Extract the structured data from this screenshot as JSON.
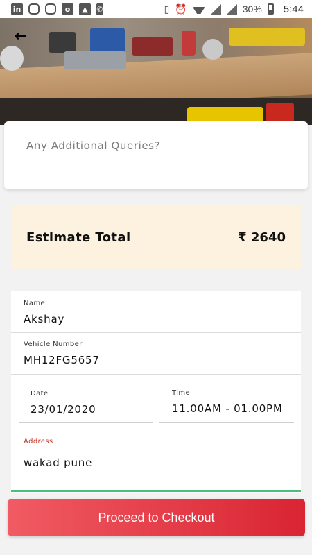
{
  "status_bar": {
    "battery": "30%",
    "time": "5:44",
    "left_icons": [
      "linkedin-icon",
      "instagram-icon",
      "instagram-icon",
      "outlook-icon",
      "gallery-icon",
      "phone-icon"
    ],
    "right_icons": [
      "vibrate-icon",
      "alarm-icon",
      "wifi-icon",
      "signal-icon",
      "signal-icon",
      "battery-icon"
    ]
  },
  "header": {
    "back_icon": "arrow-left-icon",
    "back_glyph": "←"
  },
  "query": {
    "placeholder": "Any Additional Queries?"
  },
  "estimate": {
    "label": "Estimate Total",
    "amount": "₹ 2640"
  },
  "form": {
    "name": {
      "label": "Name",
      "value": "Akshay"
    },
    "vehicle": {
      "label": "Vehicle Number",
      "value": "MH12FG5657"
    },
    "date": {
      "label": "Date",
      "value": "23/01/2020"
    },
    "time": {
      "label": "Time",
      "value": "11.00AM - 01.00PM"
    },
    "address": {
      "label": "Address",
      "value": "wakad pune"
    }
  },
  "checkout": {
    "label": "Proceed to Checkout"
  },
  "colors": {
    "accent": "#e03a45",
    "estimate_bg": "#fdf1df",
    "address_label": "#c0392b",
    "focus_line": "#49c07a"
  }
}
